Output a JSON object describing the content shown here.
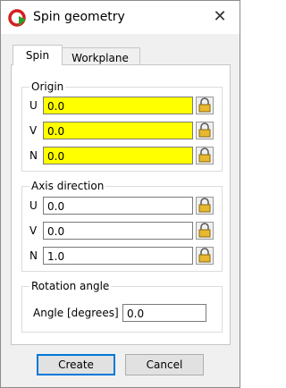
{
  "window": {
    "title": "Spin geometry",
    "icon": "app-logo-icon",
    "close_icon": "close-icon"
  },
  "tabs": [
    {
      "label": "Spin",
      "active": true
    },
    {
      "label": "Workplane",
      "active": false
    }
  ],
  "origin": {
    "title": "Origin",
    "rows": [
      {
        "label": "U",
        "value": "0.0"
      },
      {
        "label": "V",
        "value": "0.0"
      },
      {
        "label": "N",
        "value": "0.0"
      }
    ]
  },
  "axis": {
    "title": "Axis direction",
    "rows": [
      {
        "label": "U",
        "value": "0.0"
      },
      {
        "label": "V",
        "value": "0.0"
      },
      {
        "label": "N",
        "value": "1.0"
      }
    ]
  },
  "rotation": {
    "title": "Rotation angle",
    "label": "Angle [degrees]",
    "value": "0.0"
  },
  "buttons": {
    "create": "Create",
    "cancel": "Cancel"
  },
  "colors": {
    "highlight": "#ffff00",
    "default_button_border": "#0078d7",
    "lock": "#e8b830"
  }
}
